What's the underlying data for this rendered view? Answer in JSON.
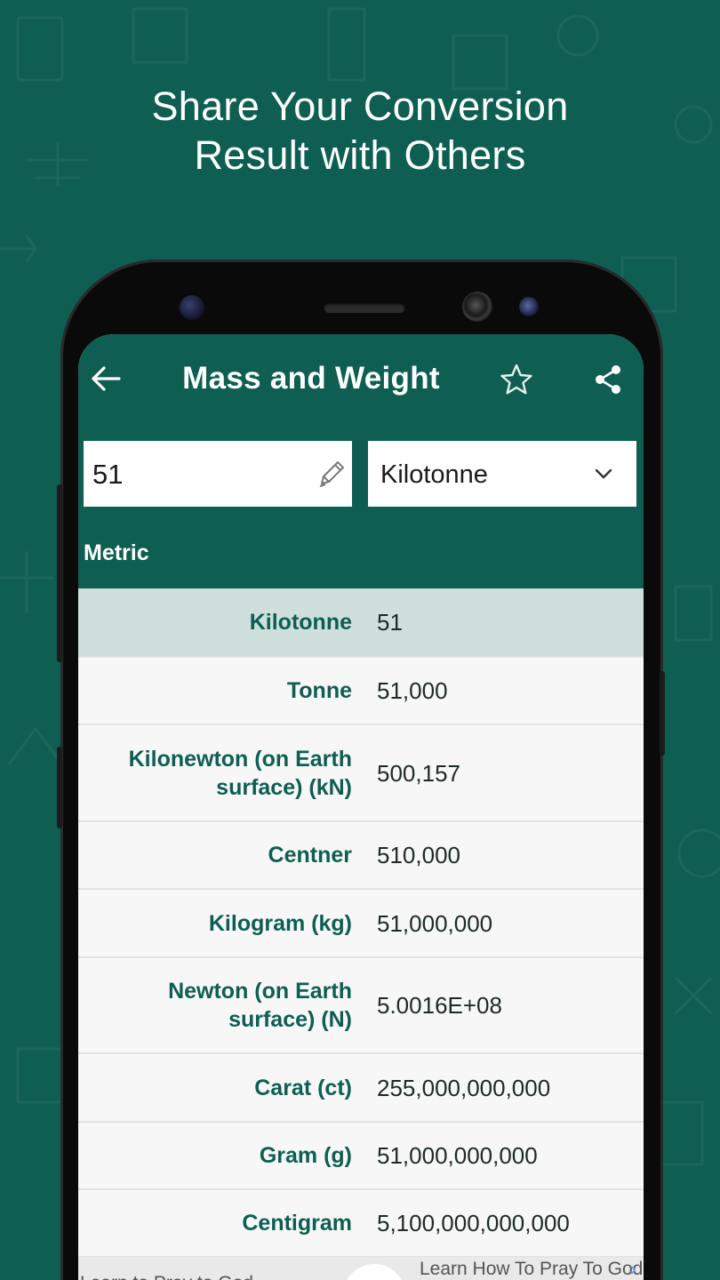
{
  "headline": {
    "line1": "Share Your Conversion",
    "line2": "Result with Others"
  },
  "appbar": {
    "title": "Mass and Weight",
    "back_icon": "arrow-left-icon",
    "favorite_icon": "star-outline-icon",
    "share_icon": "share-icon"
  },
  "input": {
    "value": "51",
    "edit_icon": "pencil-icon"
  },
  "unit_select": {
    "selected": "Kilotonne",
    "icon": "chevron-down-icon"
  },
  "section": "Metric",
  "rows": [
    {
      "unit": "Kilotonne",
      "value": "51",
      "highlighted": true
    },
    {
      "unit": "Tonne",
      "value": "51,000"
    },
    {
      "unit": "Kilonewton (on Earth surface) (kN)",
      "value": "500,157"
    },
    {
      "unit": "Centner",
      "value": "510,000"
    },
    {
      "unit": "Kilogram (kg)",
      "value": "51,000,000"
    },
    {
      "unit": "Newton (on Earth surface) (N)",
      "value": "5.0016E+08"
    },
    {
      "unit": "Carat (ct)",
      "value": "255,000,000,000"
    },
    {
      "unit": "Gram (g)",
      "value": "51,000,000,000"
    },
    {
      "unit": "Centigram",
      "value": "5,100,000,000,000"
    }
  ],
  "ad": {
    "left_text": "Learn to Pray to God",
    "right_text": "Learn How To Pray To God"
  },
  "colors": {
    "brand": "#0e5e51",
    "highlight_row": "#cfe0dc",
    "unit_text": "#0e5e51"
  }
}
